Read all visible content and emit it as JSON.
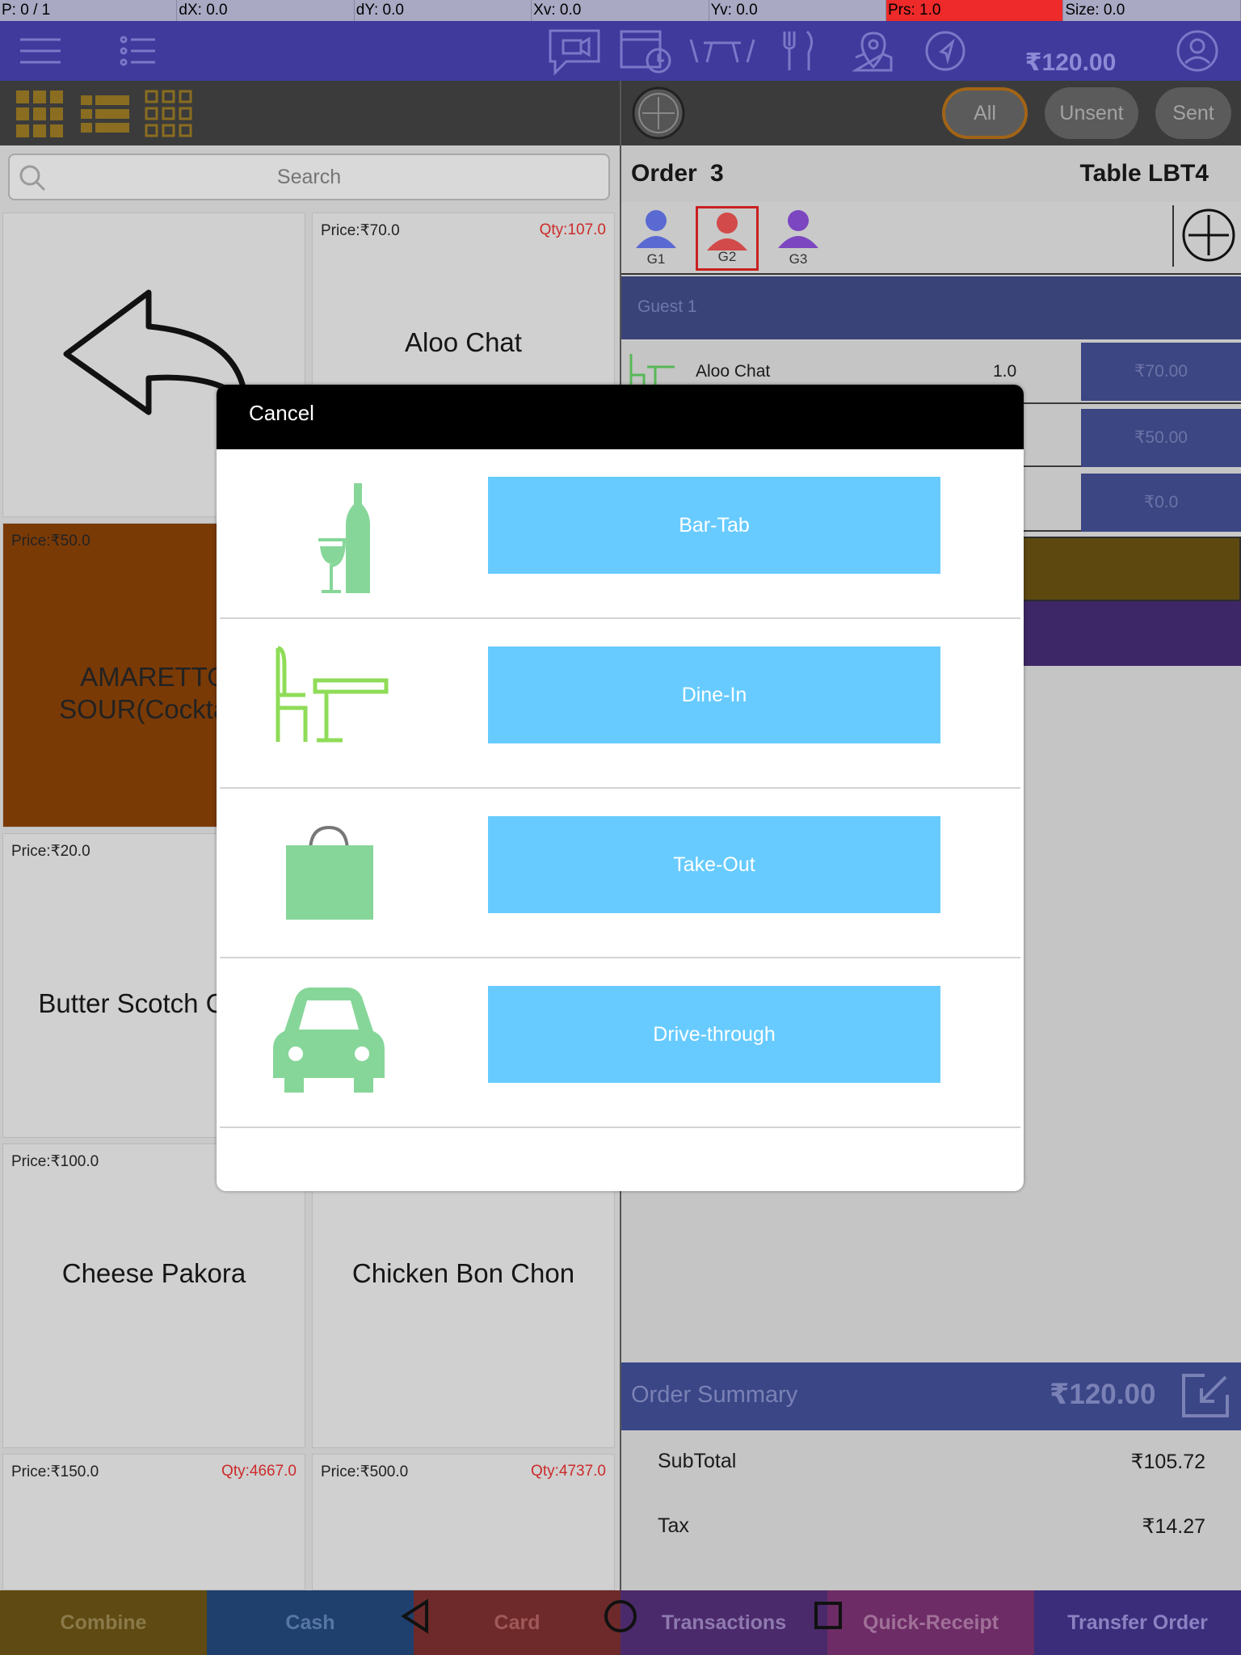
{
  "debug": {
    "pointer": "P: 0 / 1",
    "dx": "dX: 0.0",
    "dy": "dY: 0.0",
    "xv": "Xv: 0.0",
    "yv": "Yv: 0.0",
    "prs": "Prs: 1.0",
    "size": "Size: 0.0"
  },
  "topbar": {
    "total": "₹120.00",
    "icons": [
      "hamburger-menu-icon",
      "list-icon",
      "video-chat-icon",
      "calendar-clock-icon",
      "table-icon",
      "cutlery-icon",
      "map-pin-icon",
      "navigation-icon",
      "user-profile-icon"
    ]
  },
  "search": {
    "placeholder": "Search"
  },
  "tiles": [
    {
      "price": "",
      "qty": "",
      "name": ""
    },
    {
      "price": "Price:₹70.0",
      "qty": "Qty:107.0",
      "name": "Aloo Chat"
    },
    {
      "price": "Price:₹50.0",
      "qty": "",
      "name": "AMARETTO SOUR(Cocktail)"
    },
    {
      "price": "Price:₹20.0",
      "qty": "",
      "name": "Butter Scotch Cone"
    },
    {
      "price": "Price:₹100.0",
      "qty": "",
      "name": "Cheese Pakora"
    },
    {
      "price": "",
      "qty": "",
      "name": "Chicken Bon Chon"
    },
    {
      "price": "Price:₹150.0",
      "qty": "Qty:4667.0",
      "name": ""
    },
    {
      "price": "Price:₹500.0",
      "qty": "Qty:4737.0",
      "name": ""
    }
  ],
  "filters": {
    "all": "All",
    "unsent": "Unsent",
    "sent": "Sent"
  },
  "order": {
    "label": "Order",
    "number": "3",
    "table": "Table LBT4"
  },
  "guests": [
    {
      "label": "G1",
      "color": "#5a6ad2"
    },
    {
      "label": "G2",
      "color": "#d24a4a"
    },
    {
      "label": "G3",
      "color": "#7c46c0"
    }
  ],
  "guest_section": "Guest 1",
  "items": [
    {
      "name": "Aloo Chat",
      "qty": "1.0",
      "price": "₹70.00"
    },
    {
      "name": "",
      "qty": "",
      "price": "₹50.00"
    },
    {
      "name": "",
      "qty": "",
      "price": "₹0.0"
    }
  ],
  "summary": {
    "title": "Order Summary",
    "total": "₹120.00",
    "rows": [
      {
        "k": "SubTotal",
        "v": "₹105.72"
      },
      {
        "k": "Tax",
        "v": "₹14.27"
      }
    ]
  },
  "bottom": [
    "Combine",
    "Cash",
    "Card",
    "Transactions",
    "Quick-Receipt",
    "Transfer Order"
  ],
  "bottom_colors": [
    "#5e4a12",
    "#1f3f6c",
    "#6e2a2a",
    "#4a2a6a",
    "#6d2c66",
    "#3b2d7a"
  ],
  "modal": {
    "cancel": "Cancel",
    "options": [
      {
        "label": "Bar-Tab",
        "icon": "bottle-glass-icon"
      },
      {
        "label": "Dine-In",
        "icon": "chair-table-icon"
      },
      {
        "label": "Take-Out",
        "icon": "shopping-bag-icon"
      },
      {
        "label": "Drive-through",
        "icon": "car-icon"
      }
    ]
  }
}
